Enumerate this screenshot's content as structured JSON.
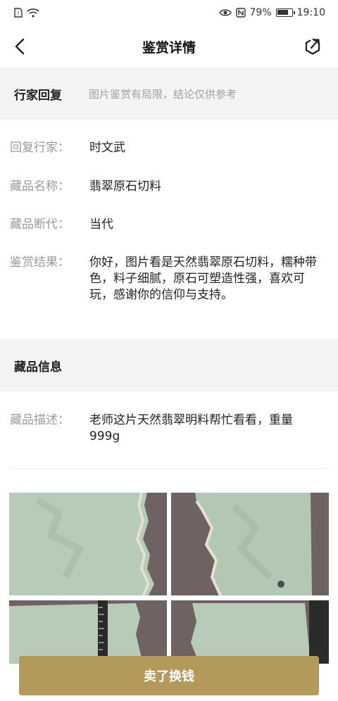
{
  "status_bar": {
    "battery": "79%",
    "battery_level": 0.79,
    "time": "19:10",
    "icons": [
      "sim-icon",
      "wifi-icon",
      "eye-icon",
      "nfc-icon",
      "battery-icon"
    ]
  },
  "nav": {
    "title": "鉴赏详情",
    "back_icon": "back-chevron-icon",
    "share_icon": "share-icon"
  },
  "expert_reply": {
    "section_title": "行家回复",
    "note": "图片鉴赏有局限，结论仅供参考",
    "rows": [
      {
        "label": "回复行家：",
        "value": "时文武"
      },
      {
        "label": "藏品名称：",
        "value": "翡翠原石切料"
      },
      {
        "label": "藏品断代：",
        "value": "当代"
      },
      {
        "label": "鉴赏结果：",
        "value": "你好，图片看是天然翡翠原石切料，糯种带色，料子细腻，原石可塑造性强，喜欢可玩，感谢你的信仰与支持。"
      }
    ]
  },
  "item_info": {
    "section_title": "藏品信息",
    "rows": [
      {
        "label": "藏品描述：",
        "value": "老师这片天然翡翠明料帮忙看看，重量999g"
      }
    ]
  },
  "photos": [
    "jade-photo-1",
    "jade-photo-2",
    "jade-photo-3",
    "jade-photo-4"
  ],
  "actions": {
    "sell_label": "卖了换钱",
    "accent": "#b39a5a"
  }
}
